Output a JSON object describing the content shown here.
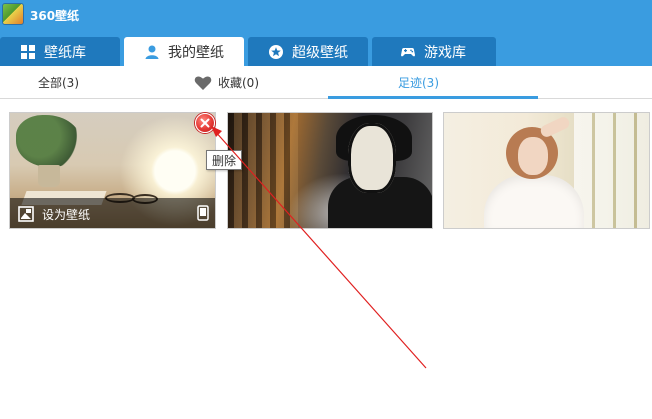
{
  "app": {
    "title": "360壁纸",
    "logo_icon": "app-logo-icon"
  },
  "tabs": [
    {
      "label": "壁纸库",
      "icon": "grid-icon",
      "active": false
    },
    {
      "label": "我的壁纸",
      "icon": "user-icon",
      "active": true
    },
    {
      "label": "超级壁纸",
      "icon": "star-icon",
      "active": false
    },
    {
      "label": "游戏库",
      "icon": "gamepad-icon",
      "active": false
    }
  ],
  "subtabs": [
    {
      "label": "全部(3)",
      "active": false
    },
    {
      "label": "收藏(0)",
      "icon": "heart-icon",
      "active": false
    },
    {
      "label": "足迹(3)",
      "active": true
    }
  ],
  "cards": [
    {
      "theme": "lamp-still-life"
    },
    {
      "theme": "dark-illustration"
    },
    {
      "theme": "girl-by-window"
    }
  ],
  "hover_overlay": {
    "label": "设为壁纸",
    "icon": "set-wallpaper-icon",
    "right_icon": "phone-icon"
  },
  "delete_tooltip": "删除",
  "colors": {
    "accent": "#3a9ce0",
    "tab_dark": "#1f79bd",
    "delete_red": "#e53935",
    "annotation_red": "#e02020"
  }
}
